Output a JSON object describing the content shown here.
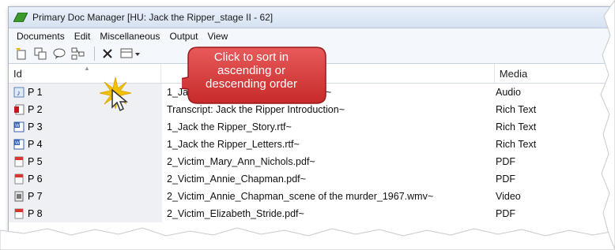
{
  "window": {
    "title": "Primary Doc Manager [HU: Jack the Ripper_stage II - 62]"
  },
  "menu": [
    "Documents",
    "Edit",
    "Miscellaneous",
    "Output",
    "View"
  ],
  "columns": {
    "id": "Id",
    "media": "Media"
  },
  "callout": {
    "line1": "Click to sort in",
    "line2": "ascending or",
    "line3": "descending order"
  },
  "rows": [
    {
      "id": "P 1",
      "icon": "audio-icon",
      "name": "1_Jack the Ripper_Introduction.mp3~",
      "media": "Audio"
    },
    {
      "id": "P 2",
      "icon": "transcript-icon",
      "name": "Transcript: Jack the Ripper Introduction~",
      "media": "Rich Text"
    },
    {
      "id": "P 3",
      "icon": "word-doc-icon",
      "name": "1_Jack the Ripper_Story.rtf~",
      "media": "Rich Text"
    },
    {
      "id": "P 4",
      "icon": "word-doc-icon",
      "name": "1_Jack the Ripper_Letters.rtf~",
      "media": "Rich Text"
    },
    {
      "id": "P 5",
      "icon": "pdf-icon",
      "name": "2_Victim_Mary_Ann_Nichols.pdf~",
      "media": "PDF"
    },
    {
      "id": "P 6",
      "icon": "pdf-icon",
      "name": "2_Victim_Annie_Chapman.pdf~",
      "media": "PDF"
    },
    {
      "id": "P 7",
      "icon": "video-icon",
      "name": "2_Victim_Annie_Chapman_scene of the murder_1967.wmv~",
      "media": "Video"
    },
    {
      "id": "P 8",
      "icon": "pdf-icon",
      "name": "2_Victim_Elizabeth_Stride.pdf~",
      "media": "PDF"
    }
  ],
  "colors": {
    "callout": "#d93a3a",
    "burst": "#f2c200"
  }
}
